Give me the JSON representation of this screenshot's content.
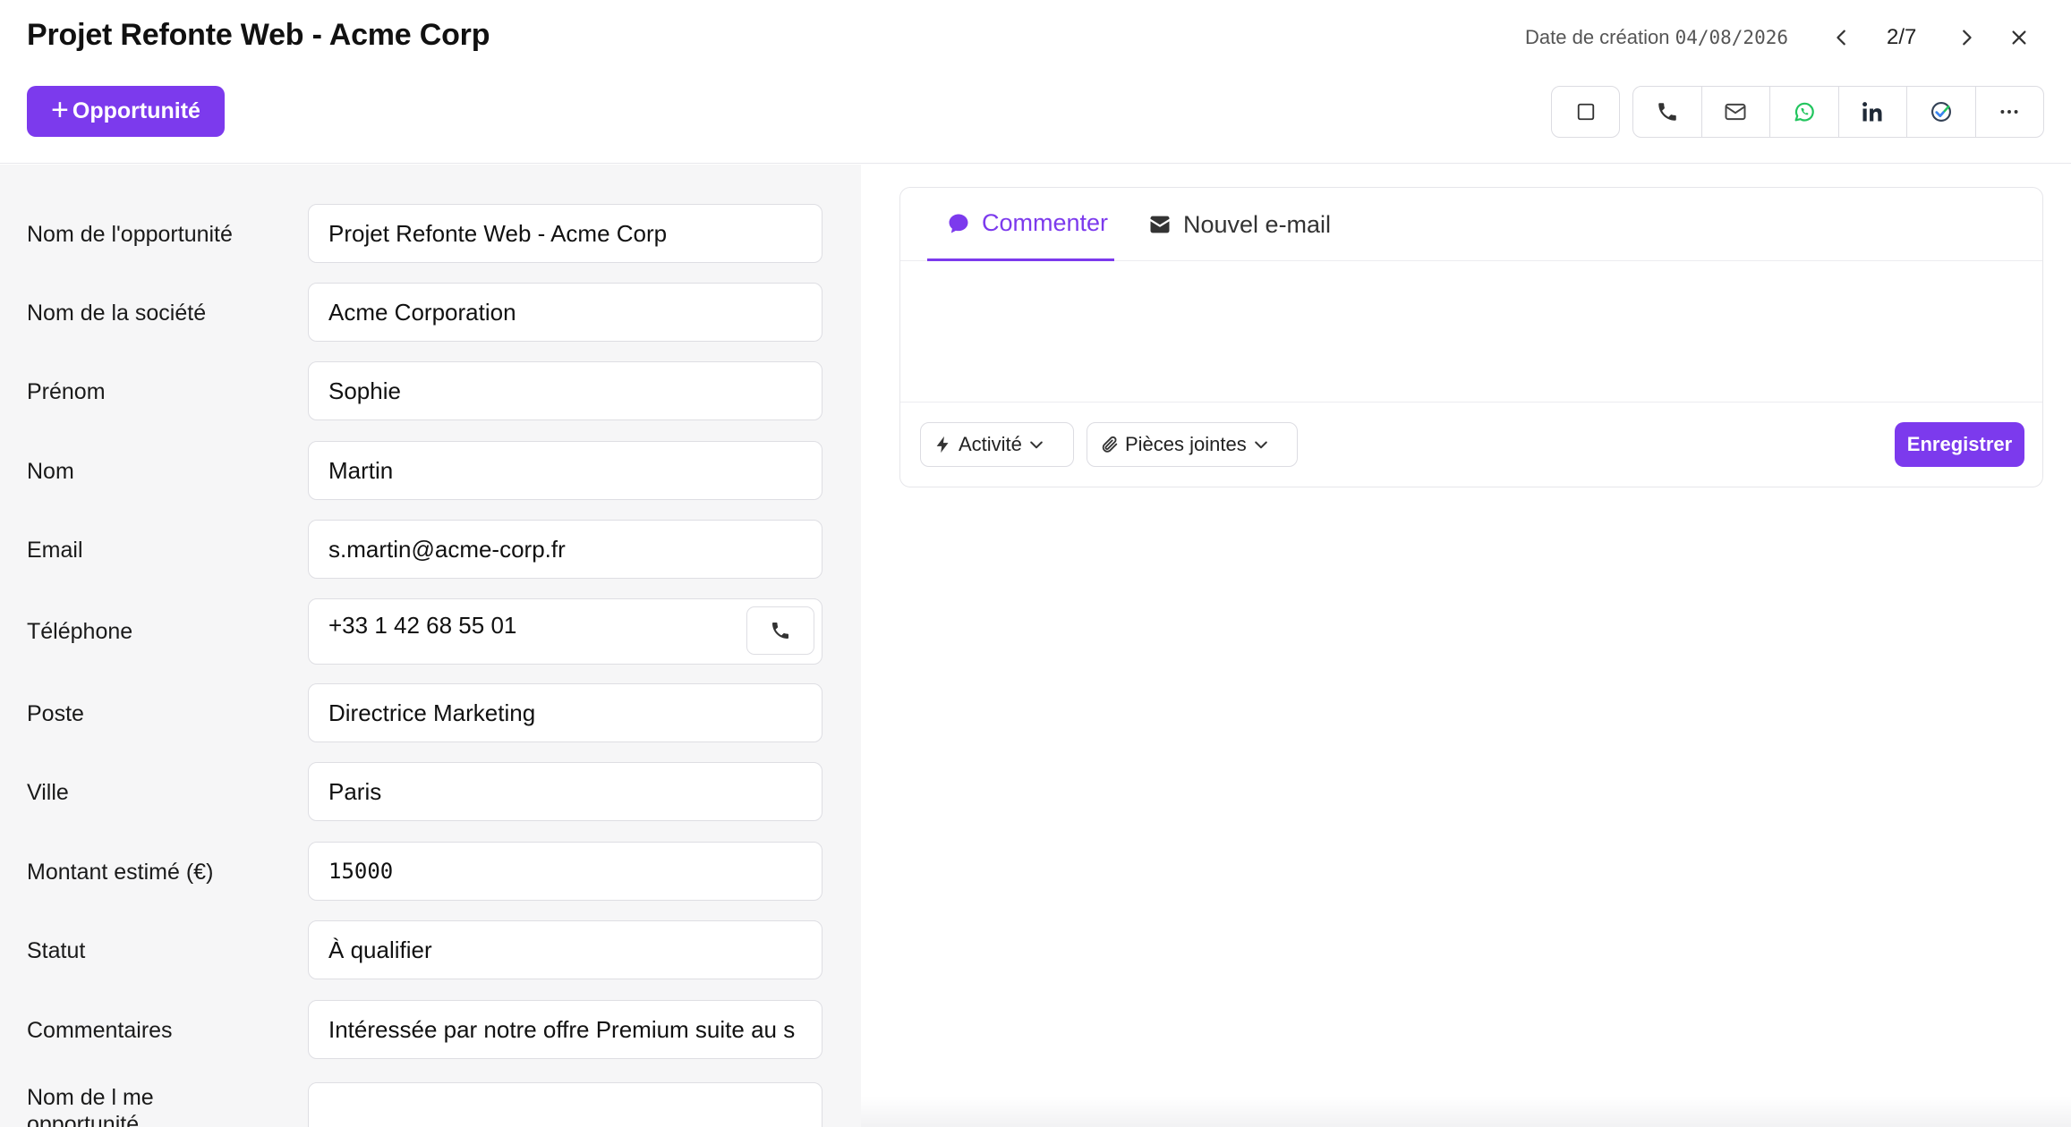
{
  "header": {
    "title": "Projet Refonte Web - Acme Corp",
    "add_button_plus": "+",
    "add_button_label": "Opportunité",
    "created_label": "Date de création",
    "created_value": "04/08/2026",
    "pager": "2/7"
  },
  "toolbar": {
    "icons": [
      "checkbox-icon",
      "phone-icon",
      "mail-icon",
      "whatsapp-icon",
      "linkedin-icon",
      "check-circle-icon",
      "more-icon"
    ]
  },
  "form": {
    "fields": [
      {
        "label": "Nom de l'opportunité",
        "value": "Projet Refonte Web - Acme Corp"
      },
      {
        "label": "Nom de la société",
        "value": "Acme Corporation"
      },
      {
        "label": "Prénom",
        "value": "Sophie"
      },
      {
        "label": "Nom",
        "value": "Martin"
      },
      {
        "label": "Email",
        "value": "s.martin@acme-corp.fr"
      },
      {
        "label": "Téléphone",
        "value": "+33 1 42 68 55 01"
      },
      {
        "label": "Poste",
        "value": "Directrice Marketing"
      },
      {
        "label": "Ville",
        "value": "Paris"
      },
      {
        "label": "Montant estimé (€)",
        "value": "15000"
      },
      {
        "label": "Statut",
        "value": "À qualifier"
      },
      {
        "label": "Commentaires",
        "value": "Intéressée par notre offre Premium suite au s"
      },
      {
        "label": "Nom de l me opportunité",
        "value": ""
      }
    ]
  },
  "composer": {
    "tab_comment": "Commenter",
    "tab_email": "Nouvel e-mail",
    "activity_label": "Activité",
    "attachments_label": "Pièces jointes",
    "save_label": "Enregistrer"
  },
  "colors": {
    "accent": "#7c3aed",
    "whatsapp": "#22c55e",
    "linkedin": "#1f2937"
  }
}
